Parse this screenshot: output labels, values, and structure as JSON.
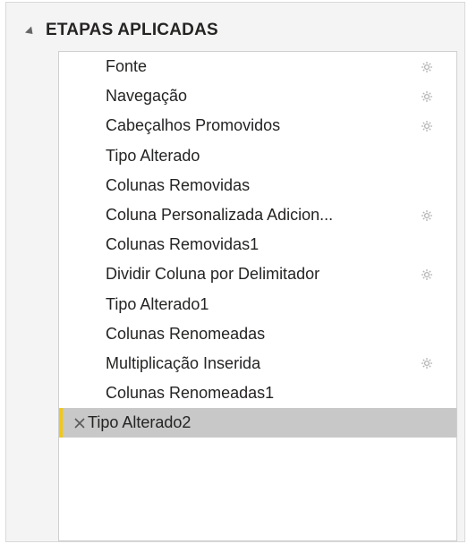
{
  "applied_steps": {
    "title": "ETAPAS APLICADAS",
    "collapse_icon": "triangle-down-icon",
    "gear_icon": "gear-icon",
    "delete_icon": "close-icon",
    "selected_accent": "#f2c811",
    "steps": [
      {
        "label": "Fonte",
        "has_settings": true
      },
      {
        "label": "Navegação",
        "has_settings": true
      },
      {
        "label": "Cabeçalhos Promovidos",
        "has_settings": true
      },
      {
        "label": "Tipo Alterado",
        "has_settings": false
      },
      {
        "label": "Colunas Removidas",
        "has_settings": false
      },
      {
        "label": "Coluna Personalizada Adicion...",
        "has_settings": true
      },
      {
        "label": "Colunas Removidas1",
        "has_settings": false
      },
      {
        "label": "Dividir Coluna por Delimitador",
        "has_settings": true
      },
      {
        "label": "Tipo Alterado1",
        "has_settings": false
      },
      {
        "label": "Colunas Renomeadas",
        "has_settings": false
      },
      {
        "label": "Multiplicação Inserida",
        "has_settings": true
      },
      {
        "label": "Colunas Renomeadas1",
        "has_settings": false
      },
      {
        "label": "Tipo Alterado2",
        "has_settings": false,
        "selected": true
      }
    ]
  }
}
